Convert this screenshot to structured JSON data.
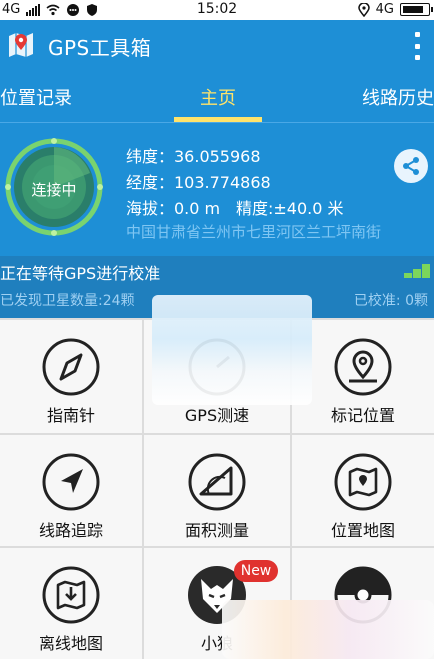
{
  "status_bar": {
    "network_left": "4G",
    "time": "15:02",
    "network_right": "4G",
    "icons": [
      "signal-icon",
      "wifi-icon",
      "chat-icon",
      "shield-icon",
      "location-icon",
      "battery-icon"
    ]
  },
  "app": {
    "title": "GPS工具箱",
    "logo_icon": "map-pin-logo-icon",
    "menu_icon": "more-vertical-icon",
    "accent_color": "#1e8fd6",
    "active_tab_color": "#ffe36a"
  },
  "tabs": [
    {
      "label": "位置记录"
    },
    {
      "label": "主页"
    },
    {
      "label": "线路历史"
    }
  ],
  "status": {
    "connect_label": "连接中",
    "latitude": "纬度：36.055968",
    "longitude": "经度：103.774868",
    "altitude": "海拔：0.0 m",
    "accuracy": "精度:±40.0 米",
    "address": "中国甘肃省兰州市七里河区兰工坪南街",
    "share_icon": "share-icon"
  },
  "gps": {
    "waiting": "正在等待GPS进行校准",
    "satellites": "已发现卫星数量:24颗",
    "calibrated": "已校准: 0颗"
  },
  "tools": [
    {
      "label": "指南针",
      "icon": "compass-icon"
    },
    {
      "label": "GPS测速",
      "icon": "speedometer-icon"
    },
    {
      "label": "标记位置",
      "icon": "map-marker-icon"
    },
    {
      "label": "线路追踪",
      "icon": "navigation-arrow-icon"
    },
    {
      "label": "面积测量",
      "icon": "protractor-icon"
    },
    {
      "label": "位置地图",
      "icon": "map-location-icon"
    },
    {
      "label": "离线地图",
      "icon": "offline-map-icon"
    },
    {
      "label": "小狼",
      "icon": "wolf-icon",
      "badge": "New"
    },
    {
      "label": "",
      "icon": "pokeball-icon"
    }
  ]
}
